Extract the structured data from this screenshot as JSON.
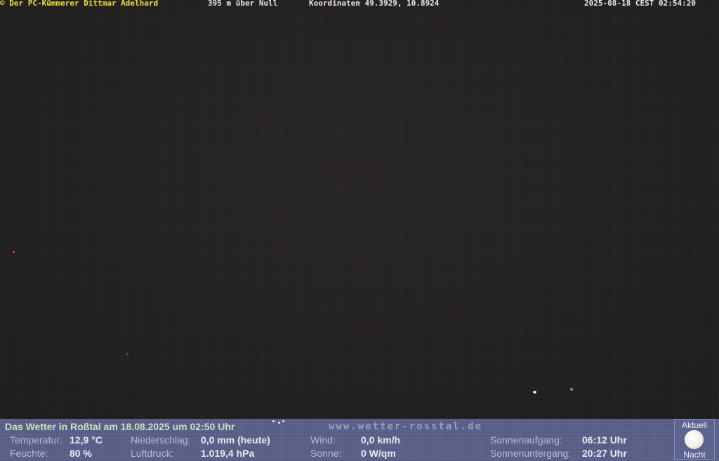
{
  "overlay": {
    "copyright": "© Der PC-Kümmerer Dittmar Adelhard",
    "altitude": "395 m über Null",
    "coords": "Koordinaten 49.3929, 10.8924",
    "timestamp": "2025-08-18 CEST 02:54:20"
  },
  "panel": {
    "title": "Das Wetter in Roßtal am 18.08.2025 um 02:50 Uhr",
    "site": "www.wetter-rosstal.de",
    "temp_label": "Temperatur:",
    "temp_value": "12,9 °C",
    "humid_label": "Feuchte:",
    "humid_value": "80 %",
    "rain_label": "Niederschlag:",
    "rain_value": "0,0 mm (heute)",
    "press_label": "Luftdruck:",
    "press_value": "1.019,4 hPa",
    "wind_label": "Wind:",
    "wind_value": "0,0 km/h",
    "sun_label": "Sonne:",
    "sun_value": "0 W/qm",
    "sunrise_label": "Sonnenaufgang:",
    "sunrise_value": "06:12 Uhr",
    "sunset_label": "Sonnenuntergang:",
    "sunset_value": "20:27 Uhr",
    "moon_top": "Aktuell",
    "moon_bottom": "Nacht",
    "moon_icon": "moon-icon"
  },
  "colors": {
    "overlay_yellow": "#f0e23a",
    "panel_bg": "#5a608a",
    "title_green": "#cfe0c0"
  }
}
